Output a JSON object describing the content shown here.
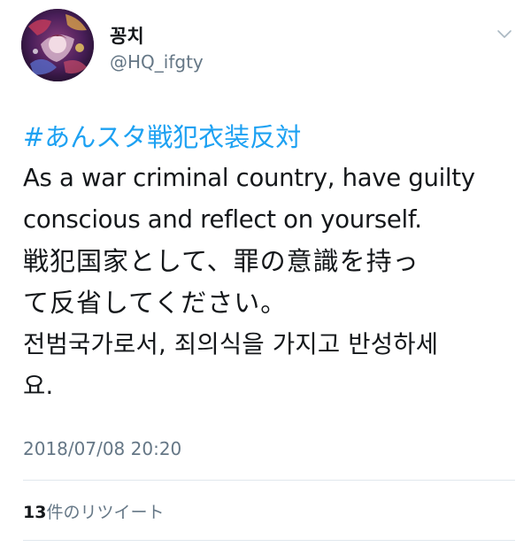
{
  "user": {
    "display_name": "꽁치",
    "handle": "@HQ_ifgty"
  },
  "tweet": {
    "hashtag": "#あんスタ戦犯衣装反対",
    "lines": [
      "As  a war criminal country, have guilty",
      "conscious and reflect on yourself.",
      "戦犯国家として、罪の意識を持っ",
      "て反省してください。",
      "전범국가로서, 죄의식을 가지고 반성하세",
      "요."
    ],
    "timestamp": "2018/07/08 20:20"
  },
  "stats": {
    "retweet_count": "13",
    "retweet_label": "件のリツイート"
  },
  "icons": {
    "menu": "chevron-down-icon"
  },
  "colors": {
    "link": "#1da1f2",
    "secondary_text": "#657786",
    "primary_text": "#14171a",
    "divider": "#e1e8ed"
  }
}
